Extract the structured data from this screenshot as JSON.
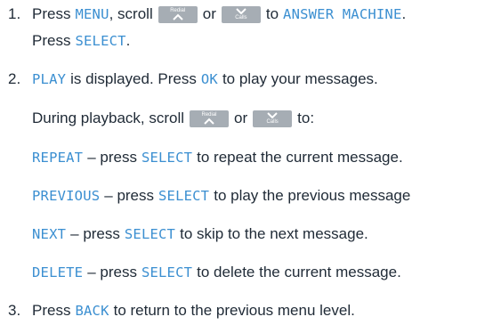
{
  "keys": {
    "redial_label": "Redial",
    "calls_label": "Calls"
  },
  "step1": {
    "number": "1.",
    "t1": "Press",
    "menu": "MENU",
    "t2": ", scroll",
    "or": "or",
    "to": "to",
    "answer_machine": "ANSWER MACHINE",
    "t3": ".",
    "press": "Press",
    "select": "SELECT",
    "end": "."
  },
  "step2": {
    "number": "2.",
    "play": "PLAY",
    "t1": "is displayed. Press",
    "ok": "OK",
    "t2": "to play your messages.",
    "during": "During playback, scroll",
    "or": "or",
    "to": "to:",
    "options": [
      {
        "cmd": "REPEAT",
        "dash": "– press",
        "key": "SELECT",
        "desc": "to repeat the current message."
      },
      {
        "cmd": "PREVIOUS",
        "dash": "– press",
        "key": "SELECT",
        "desc": "to play the previous message"
      },
      {
        "cmd": "NEXT",
        "dash": "– press",
        "key": "SELECT",
        "desc": "to skip to the next message."
      },
      {
        "cmd": "DELETE",
        "dash": "– press",
        "key": "SELECT",
        "desc": "to delete the current message."
      }
    ]
  },
  "step3": {
    "number": "3.",
    "t1": "Press",
    "back": "BACK",
    "t2": "to return to the previous menu level."
  }
}
